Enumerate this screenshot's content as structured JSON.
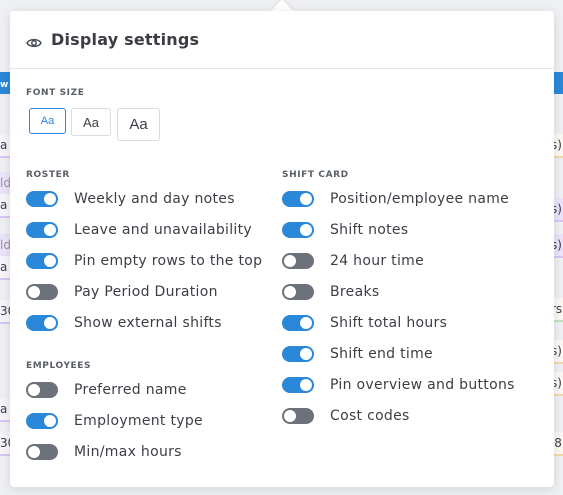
{
  "background": {
    "left_fragments": [
      "w",
      "a",
      "ld",
      "a",
      "ld",
      "a",
      "30",
      "a",
      "30"
    ],
    "right_fragments": [
      "s)",
      "s)",
      "s)",
      "rs",
      "s)",
      "s)",
      "'8"
    ]
  },
  "panel": {
    "title": "Display settings",
    "icon": "eye-icon"
  },
  "font_size": {
    "label": "FONT SIZE",
    "options": [
      {
        "label": "Aa",
        "selected": true
      },
      {
        "label": "Aa",
        "selected": false
      },
      {
        "label": "Aa",
        "selected": false
      }
    ]
  },
  "roster": {
    "label": "ROSTER",
    "items": [
      {
        "label": "Weekly and day notes",
        "on": true
      },
      {
        "label": "Leave and unavailability",
        "on": true
      },
      {
        "label": "Pin empty rows to the top",
        "on": true
      },
      {
        "label": "Pay Period Duration",
        "on": false
      },
      {
        "label": "Show external shifts",
        "on": true
      }
    ]
  },
  "employees": {
    "label": "EMPLOYEES",
    "items": [
      {
        "label": "Preferred name",
        "on": false
      },
      {
        "label": "Employment type",
        "on": true
      },
      {
        "label": "Min/max hours",
        "on": false
      }
    ]
  },
  "shift_card": {
    "label": "SHIFT CARD",
    "items": [
      {
        "label": "Position/employee name",
        "on": true
      },
      {
        "label": "Shift notes",
        "on": true
      },
      {
        "label": "24 hour time",
        "on": false
      },
      {
        "label": "Breaks",
        "on": false
      },
      {
        "label": "Shift total hours",
        "on": true
      },
      {
        "label": "Shift end time",
        "on": true
      },
      {
        "label": "Pin overview and buttons",
        "on": true
      },
      {
        "label": "Cost codes",
        "on": false
      }
    ]
  },
  "colors": {
    "accent": "#2b88d8",
    "toggle_off": "#6d727a"
  }
}
